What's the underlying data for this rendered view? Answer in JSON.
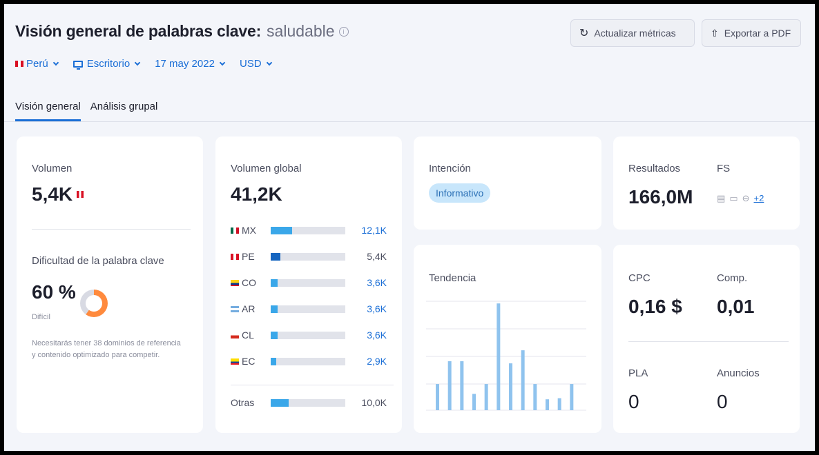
{
  "header": {
    "title": "Visión general de palabras clave:",
    "keyword": "saludable",
    "update_btn": "Actualizar métricas",
    "export_btn": "Exportar a PDF"
  },
  "filters": {
    "country": "Perú",
    "device": "Escritorio",
    "date": "17 may 2022",
    "currency": "USD"
  },
  "tabs": [
    "Visión general",
    "Análisis grupal"
  ],
  "volume": {
    "label": "Volumen",
    "value": "5,4K",
    "difficulty_label": "Dificultad de la palabra clave",
    "difficulty_value": "60 %",
    "difficulty_level": "Difícil",
    "difficulty_percent": 60,
    "difficulty_note": "Necesitarás tener 38 dominios de referencia y contenido optimizado para competir."
  },
  "global_volume": {
    "label": "Volumen global",
    "value": "41,2K",
    "countries": [
      {
        "code": "MX",
        "value": "12,1K",
        "fraction": 0.29,
        "linked": true
      },
      {
        "code": "PE",
        "value": "5,4K",
        "fraction": 0.13,
        "linked": false
      },
      {
        "code": "CO",
        "value": "3,6K",
        "fraction": 0.09,
        "linked": true
      },
      {
        "code": "AR",
        "value": "3,6K",
        "fraction": 0.09,
        "linked": true
      },
      {
        "code": "CL",
        "value": "3,6K",
        "fraction": 0.09,
        "linked": true
      },
      {
        "code": "EC",
        "value": "2,9K",
        "fraction": 0.07,
        "linked": true
      }
    ],
    "others_label": "Otras",
    "others_value": "10,0K",
    "others_fraction": 0.24
  },
  "intent": {
    "label": "Intención",
    "value": "Informativo"
  },
  "results": {
    "label": "Resultados",
    "value": "166,0M",
    "fs_label": "FS",
    "fs_more": "+2"
  },
  "trend": {
    "label": "Tendencia",
    "values": [
      0.24,
      0.45,
      0.45,
      0.15,
      0.24,
      0.98,
      0.43,
      0.55,
      0.24,
      0.1,
      0.11,
      0.24
    ]
  },
  "cpc": {
    "label": "CPC",
    "value": "0,16 $"
  },
  "comp": {
    "label": "Comp.",
    "value": "0,01"
  },
  "pla": {
    "label": "PLA",
    "value": "0"
  },
  "ads": {
    "label": "Anuncios",
    "value": "0"
  },
  "colors": {
    "accent": "#1a6ed6",
    "bar": "#3aa7e9",
    "bar_pe": "#1565c0",
    "trend": "#8fc3ee",
    "donut": "#ff8a3d"
  }
}
